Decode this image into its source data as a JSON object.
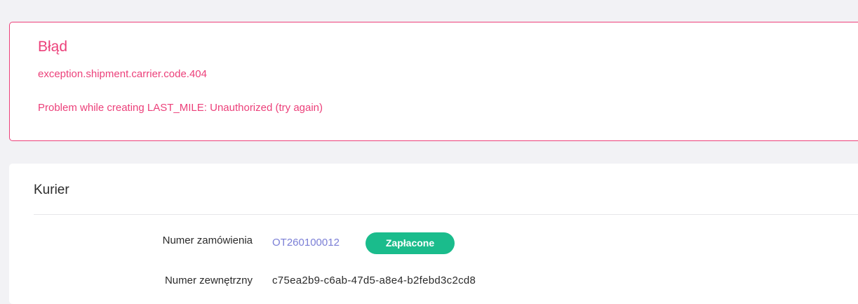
{
  "error": {
    "title": "Błąd",
    "code": "exception.shipment.carrier.code.404",
    "message": "Problem while creating LAST_MILE: Unauthorized (try again)"
  },
  "courier": {
    "title": "Kurier",
    "order_number_label": "Numer zamówienia",
    "order_number_value": "OT260100012",
    "status_badge": "Zapłacone",
    "external_number_label": "Numer zewnętrzny",
    "external_number_value": "c75ea2b9-c6ab-47d5-a8e4-b2febd3c2cd8"
  },
  "colors": {
    "error": "#ec407a",
    "link": "#7b7fd6",
    "badge": "#1abc8c",
    "background": "#f2f2f5"
  }
}
